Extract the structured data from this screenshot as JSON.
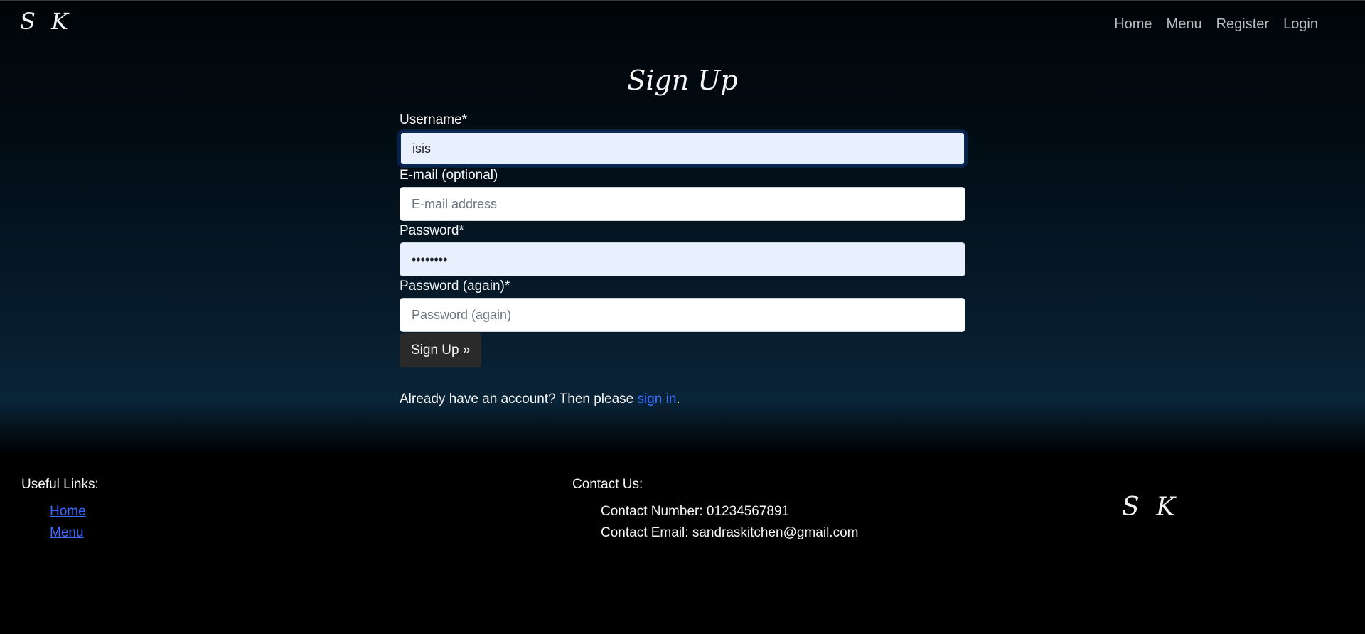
{
  "nav": {
    "brand": "S K",
    "links": [
      "Home",
      "Menu",
      "Register",
      "Login"
    ]
  },
  "form": {
    "title": "Sign Up",
    "username_label": "Username*",
    "username_value": "isis",
    "email_label": "E-mail (optional)",
    "email_placeholder": "E-mail address",
    "password_label": "Password*",
    "password_value": "••••••••",
    "password2_label": "Password (again)*",
    "password2_placeholder": "Password (again)",
    "submit_label": "Sign Up »",
    "signin_prefix": "Already have an account? Then please ",
    "signin_link": "sign in",
    "signin_suffix": "."
  },
  "footer": {
    "useful_links_heading": "Useful Links:",
    "useful_links": [
      "Home",
      "Menu"
    ],
    "contact_heading": "Contact Us:",
    "contact_number": "Contact Number: 01234567891",
    "contact_email": "Contact Email: sandraskitchen@gmail.com",
    "logo": "S K"
  },
  "colors": {
    "link": "#3b6cff",
    "button_bg": "#2a2a2a",
    "autofill_bg": "#e8f0fe"
  }
}
